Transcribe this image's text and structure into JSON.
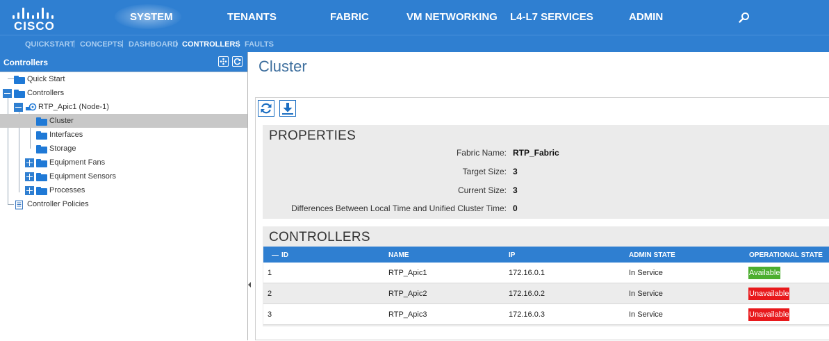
{
  "topnav": {
    "logo_text": "CISCO",
    "items": [
      "SYSTEM",
      "TENANTS",
      "FABRIC",
      "VM NETWORKING",
      "L4-L7 SERVICES",
      "ADMIN"
    ],
    "active": "SYSTEM",
    "search_icon": "search-icon"
  },
  "subnav": {
    "items": [
      "QUICKSTART",
      "CONCEPTS",
      "DASHBOARD",
      "CONTROLLERS",
      "FAULTS"
    ],
    "active": "CONTROLLERS"
  },
  "left_panel": {
    "title": "Controllers",
    "tree": [
      {
        "label": "Quick Start"
      },
      {
        "label": "Controllers"
      },
      {
        "label": "RTP_Apic1 (Node-1)"
      },
      {
        "label": "Cluster",
        "selected": true
      },
      {
        "label": "Interfaces"
      },
      {
        "label": "Storage"
      },
      {
        "label": "Equipment Fans"
      },
      {
        "label": "Equipment Sensors"
      },
      {
        "label": "Processes"
      },
      {
        "label": "Controller Policies"
      }
    ]
  },
  "main": {
    "title": "Cluster",
    "properties": {
      "heading": "PROPERTIES",
      "rows": [
        {
          "label": "Fabric Name:",
          "value": "RTP_Fabric"
        },
        {
          "label": "Target Size:",
          "value": "3"
        },
        {
          "label": "Current Size:",
          "value": "3"
        },
        {
          "label": "Differences Between Local Time and Unified Cluster Time:",
          "value": "0"
        }
      ]
    },
    "controllers": {
      "heading": "CONTROLLERS",
      "sort_indicator": "—",
      "columns": [
        "ID",
        "NAME",
        "IP",
        "ADMIN STATE",
        "OPERATIONAL STATE"
      ],
      "rows": [
        {
          "id": "1",
          "name": "RTP_Apic1",
          "ip": "172.16.0.1",
          "admin_state": "In Service",
          "operational_state": "Available"
        },
        {
          "id": "2",
          "name": "RTP_Apic2",
          "ip": "172.16.0.2",
          "admin_state": "In Service",
          "operational_state": "Unavailable"
        },
        {
          "id": "3",
          "name": "RTP_Apic3",
          "ip": "172.16.0.3",
          "admin_state": "In Service",
          "operational_state": "Unavailable"
        }
      ]
    }
  },
  "colors": {
    "brand_blue": "#2f7fd1",
    "available": "#4cae2f",
    "unavailable": "#e8191c"
  }
}
